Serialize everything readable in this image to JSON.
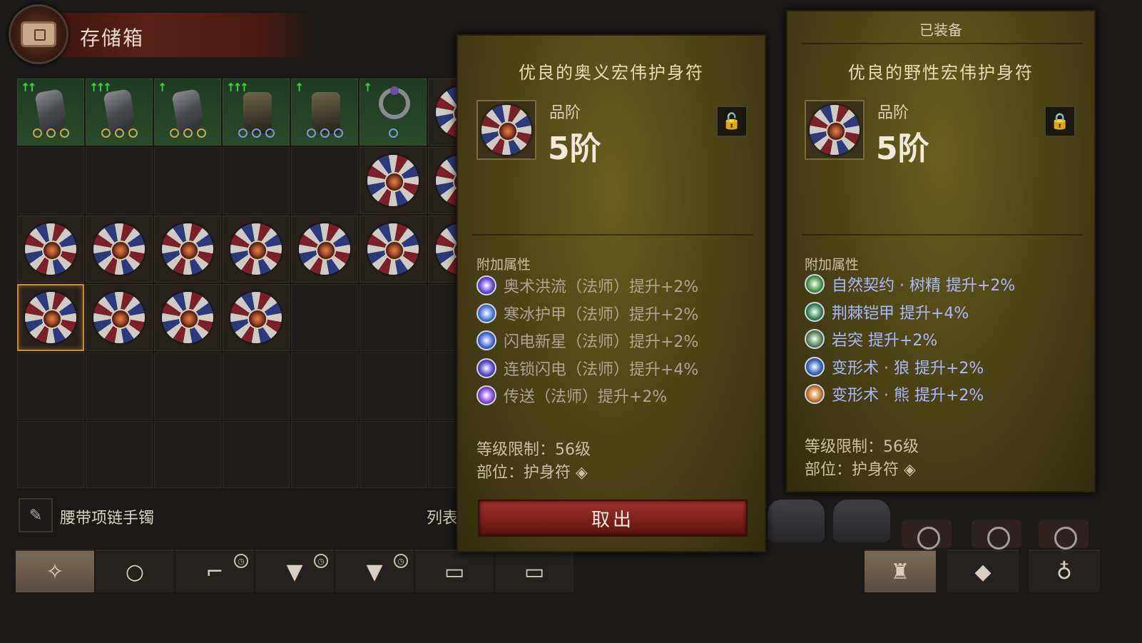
{
  "header": {
    "title": "存储箱"
  },
  "grid_rows": [
    [
      {
        "type": "glove",
        "bg": "green",
        "arrows": "↑↑",
        "dots": "gold"
      },
      {
        "type": "glove",
        "bg": "green",
        "arrows": "↑↑↑",
        "dots": "gold"
      },
      {
        "type": "glove",
        "bg": "green",
        "arrows": "↑",
        "dots": "gold"
      },
      {
        "type": "boot",
        "bg": "green",
        "arrows": "↑↑↑",
        "dots": "blue"
      },
      {
        "type": "boot",
        "bg": "green",
        "arrows": "↑",
        "dots": "blue"
      },
      {
        "type": "ring",
        "bg": "green",
        "arrows": "↑",
        "dots": "none"
      }
    ]
  ],
  "filter": {
    "label": "腰带项链手镯",
    "list_label": "列表",
    "feather_icon": "feather-icon"
  },
  "tabs": [
    {
      "icon": "amulet-tab-icon",
      "glyph": "✧",
      "active": true,
      "clock": false
    },
    {
      "icon": "ring-tab-icon",
      "glyph": "○",
      "active": false,
      "clock": false
    },
    {
      "icon": "boots-tab-icon",
      "glyph": "⌐",
      "active": false,
      "clock": true
    },
    {
      "icon": "chest-armor-tab-icon",
      "glyph": "▼",
      "active": false,
      "clock": true
    },
    {
      "icon": "chest-armor-tab-icon",
      "glyph": "▼",
      "active": false,
      "clock": true
    },
    {
      "icon": "storage-tab-icon",
      "glyph": "▭",
      "active": false,
      "clock": false
    },
    {
      "icon": "storage-tab-icon",
      "glyph": "▭",
      "active": false,
      "clock": false
    },
    {
      "icon": "helmet-tab-icon",
      "glyph": "♜",
      "active": true,
      "clock": false
    },
    {
      "icon": "materials-tab-icon",
      "glyph": "◆",
      "active": false,
      "clock": false
    },
    {
      "icon": "bag-tab-icon",
      "glyph": "♁",
      "active": false,
      "clock": false
    }
  ],
  "left_tooltip": {
    "title": "优良的奥义宏伟护身符",
    "grade_label": "品阶",
    "grade_value": "5阶",
    "lock_state": "unlocked",
    "attr_header": "附加属性",
    "attributes": [
      {
        "text": "奥术洪流（法师）提升+2%",
        "active": false,
        "color": "#6a4ad8"
      },
      {
        "text": "寒冰护甲（法师）提升+2%",
        "active": false,
        "color": "#4a7ad8"
      },
      {
        "text": "闪电新星（法师）提升+2%",
        "active": false,
        "color": "#4a6ad8"
      },
      {
        "text": "连锁闪电（法师）提升+4%",
        "active": false,
        "color": "#5a4ac8"
      },
      {
        "text": "传送（法师）提升+2%",
        "active": false,
        "color": "#8a4ad8"
      }
    ],
    "level_req": "等级限制：56级",
    "slot": "部位：护身符",
    "take_button": "取出"
  },
  "right_tooltip": {
    "equipped_label": "已装备",
    "title": "优良的野性宏伟护身符",
    "grade_label": "品阶",
    "grade_value": "5阶",
    "lock_state": "locked",
    "attr_header": "附加属性",
    "attributes": [
      {
        "text": "自然契约 · 树精  提升+2%",
        "active": true,
        "color": "#4a9a4a"
      },
      {
        "text": "荆棘铠甲  提升+4%",
        "active": true,
        "color": "#3a8a5a"
      },
      {
        "text": "岩突  提升+2%",
        "active": true,
        "color": "#5a8a5a"
      },
      {
        "text": "变形术 · 狼  提升+2%",
        "active": true,
        "color": "#3a6ab8"
      },
      {
        "text": "变形术 · 熊  提升+2%",
        "active": true,
        "color": "#c87a2a"
      }
    ],
    "level_req": "等级限制：56级",
    "slot": "部位：护身符"
  },
  "colors": {
    "selected_border": "#c98a3a",
    "take_button": "#a0322a",
    "active_attr": "#a9b8ff",
    "upgrade_arrow": "#3cd24a"
  }
}
